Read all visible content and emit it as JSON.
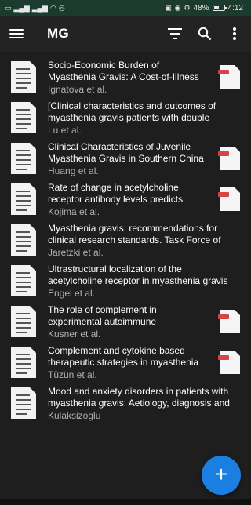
{
  "status_bar": {
    "battery": "48%",
    "time": "4:12"
  },
  "app_bar": {
    "title": "MG"
  },
  "colors": {
    "background": "#1e1e1e",
    "app_bar": "#232323",
    "status_bar": "#1b3b2f",
    "fab": "#1a7fe0",
    "author_text": "#b0b0b0"
  },
  "icons": {
    "menu": "hamburger-icon",
    "sort": "sort-icon",
    "search": "search-icon",
    "more": "more-vert-icon",
    "document": "document-icon",
    "pdf": "pdf-icon",
    "add": "plus-icon"
  },
  "items": [
    {
      "title_line1": "Socio-Economic Burden of",
      "title_line2": "Myasthenia Gravis: A Cost-of-Illness",
      "authors": "Ignatova et al.",
      "has_pdf": true
    },
    {
      "title_line1": "[Clinical characteristics and outcomes of",
      "title_line2": "myasthenia gravis patients with double",
      "authors": "Lu et al.",
      "has_pdf": false
    },
    {
      "title_line1": "Clinical Characteristics of Juvenile",
      "title_line2": "Myasthenia Gravis in Southern China",
      "authors": "Huang et al.",
      "has_pdf": true
    },
    {
      "title_line1": "Rate of change in acetylcholine",
      "title_line2": "receptor antibody levels predicts",
      "authors": "Kojima et al.",
      "has_pdf": true
    },
    {
      "title_line1": "Myasthenia gravis: recommendations for",
      "title_line2": "clinical research standards. Task Force of",
      "authors": "Jaretzki et al.",
      "has_pdf": false
    },
    {
      "title_line1": "Ultrastructural localization of the",
      "title_line2": "acetylcholine receptor in myasthenia gravis",
      "authors": "Engel et al.",
      "has_pdf": false
    },
    {
      "title_line1": "The role of complement in",
      "title_line2": "experimental autoimmune",
      "authors": "Kusner et al.",
      "has_pdf": true
    },
    {
      "title_line1": "Complement and cytokine based",
      "title_line2": "therapeutic strategies in myasthenia",
      "authors": "Tüzün et al.",
      "has_pdf": true
    },
    {
      "title_line1": "Mood and anxiety disorders in patients with",
      "title_line2": "myasthenia gravis: Aetiology, diagnosis and",
      "authors": "Kulaksizoglu",
      "has_pdf": false
    }
  ],
  "fab": {
    "label": "+"
  }
}
